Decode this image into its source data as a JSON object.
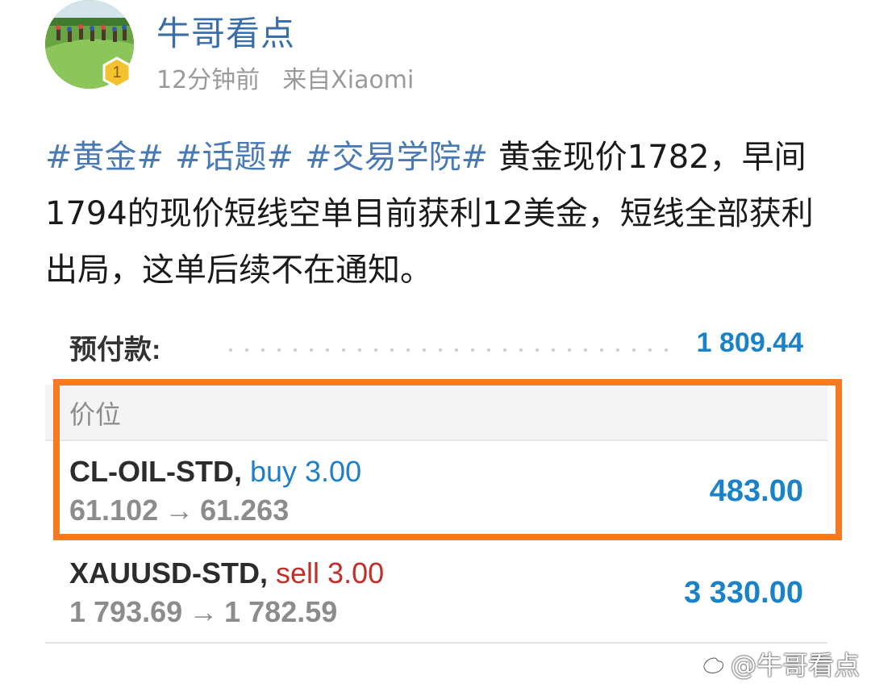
{
  "header": {
    "username": "牛哥看点",
    "time": "12分钟前",
    "source": "来自Xiaomi",
    "badge_level": "1"
  },
  "post": {
    "tags": [
      "#黄金#",
      "#话题#",
      "#交易学院#"
    ],
    "body": "黄金现价1782，早间1794的现价短线空单目前获利12美金，短线全部获利出局，这单后续不在通知。"
  },
  "account": {
    "prepay_label": "预付款:",
    "prepay_value": "1 809.44",
    "section_label": "价位"
  },
  "positions": [
    {
      "symbol": "CL-OIL-STD,",
      "side": "buy 3.00",
      "open_price": "61.102",
      "arrow": "→",
      "current_price": "61.263",
      "profit": "483.00"
    },
    {
      "symbol": "XAUUSD-STD,",
      "side": "sell 3.00",
      "open_price": "1 793.69",
      "arrow": "→",
      "current_price": "1 782.59",
      "profit": "3 330.00"
    }
  ],
  "watermark": "@牛哥看点",
  "colors": {
    "link_blue": "#3a6ea8",
    "tag_blue": "#4a7ab5",
    "value_blue": "#1a82c8",
    "sell_red": "#c0302a",
    "highlight_orange": "#f57a22",
    "badge_gold": "#f2c230"
  },
  "icons": {
    "avatar": "avatar-image",
    "badge": "level-badge-icon",
    "watermark": "weibo-logo-icon"
  }
}
